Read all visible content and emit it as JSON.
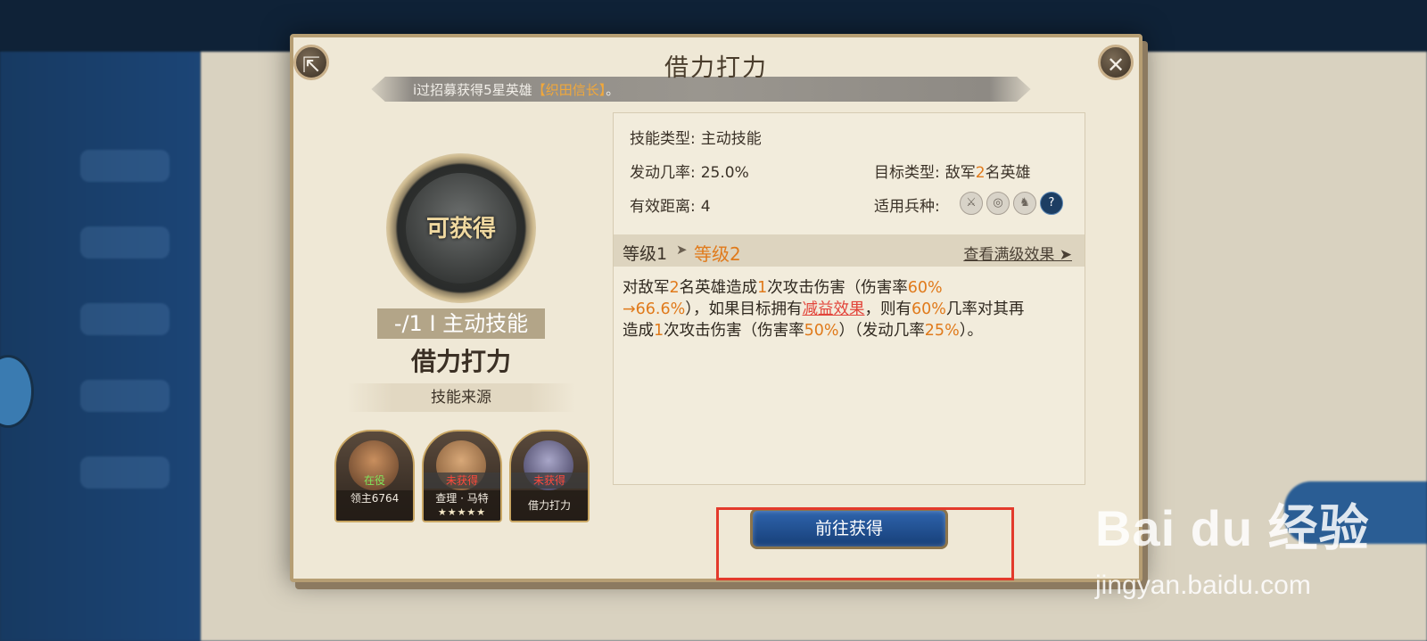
{
  "dialog": {
    "title": "借力打力",
    "notice_prefix": "i过招募获得5星英雄",
    "notice_hero": "【织田信长】",
    "notice_suffix": "。",
    "share_icon": "share-icon",
    "close_icon": "close-icon"
  },
  "skill": {
    "obtain_label": "可获得",
    "tag": "-/1 I 主动技能",
    "name": "借力打力",
    "source_label": "技能来源"
  },
  "heroes": [
    {
      "status": "在役",
      "caption": "领主6764",
      "stars": ""
    },
    {
      "status": "未获得",
      "caption": "查理 · 马特",
      "stars": "★★★★★"
    },
    {
      "status": "未获得",
      "caption": "借力打力",
      "stars": ""
    }
  ],
  "info": {
    "type_label": "技能类型:",
    "type_value": "主动技能",
    "rate_label": "发动几率:",
    "rate_value": "25.0%",
    "target_label": "目标类型:",
    "target_pre": "敌军",
    "target_num": "2",
    "target_post": "名英雄",
    "range_label": "有效距离:",
    "range_value": "4",
    "troop_label": "适用兵种:",
    "troops": [
      "sword-icon",
      "target-icon",
      "horse-icon",
      "question-icon"
    ]
  },
  "level": {
    "current": "等级1",
    "next": "等级2",
    "max_view": "查看满级效果 ➤"
  },
  "description": {
    "p1": "对敌军",
    "n1": "2",
    "p2": "名英雄造成",
    "n2": "1",
    "p3": "次攻击伤害（伤害率",
    "n3": "60%",
    "n4": "→66.6%",
    "p4": "），如果目标拥有",
    "debuff": "减益效果",
    "p5": "，则有",
    "n5": "60%",
    "p6": "几率对其再",
    "p7": "造成",
    "n6": "1",
    "p8": "次攻击伤害（伤害率",
    "n7": "50%",
    "p9": "）（发动几率",
    "n8": "25%",
    "p10": "）。"
  },
  "button": {
    "go_obtain": "前往获得"
  },
  "watermark": {
    "logo": "Bai du 经验",
    "url": "jingyan.baidu.com"
  },
  "colors": {
    "accent": "#e07a1b",
    "highlight": "#e33a2c",
    "button": "#1f4f91"
  }
}
